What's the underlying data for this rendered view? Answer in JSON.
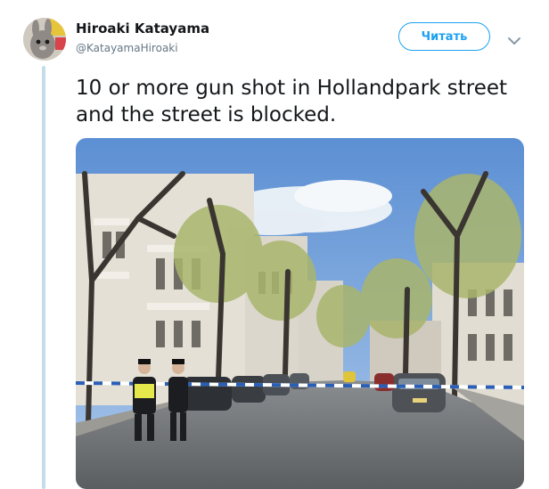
{
  "tweet": {
    "author_name": "Hiroaki Katayama",
    "author_handle": "@KatayamaHiroaki",
    "follow_label": "Читать",
    "text": "10 or more gun shot in Hollandpark street and the street is blocked.",
    "colors": {
      "accent": "#1da1f2",
      "name": "#14171a",
      "secondary": "#657786",
      "thread_line": "#c4dcec"
    },
    "icons": {
      "more": "chevron-down-icon"
    }
  }
}
